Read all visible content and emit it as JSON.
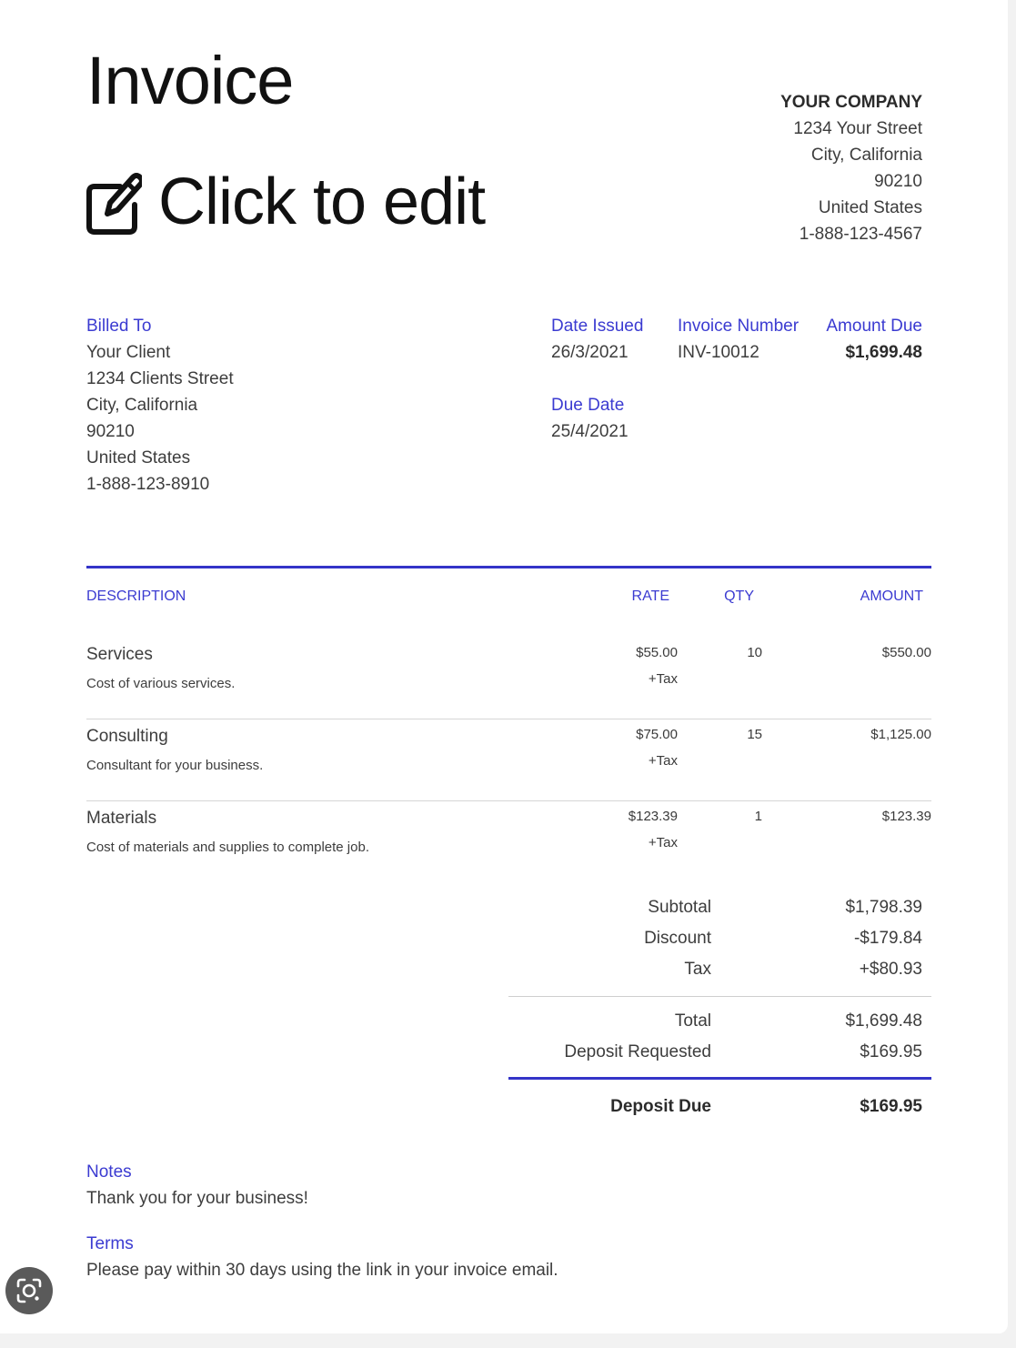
{
  "header": {
    "title": "Invoice",
    "edit_label": "Click to edit"
  },
  "company": {
    "name": "YOUR COMPANY",
    "street": "1234 Your Street",
    "city": "City, California",
    "zip": "90210",
    "country": "United States",
    "phone": "1-888-123-4567"
  },
  "billed_to": {
    "label": "Billed To",
    "name": "Your Client",
    "street": "1234 Clients Street",
    "city": "City, California",
    "zip": "90210",
    "country": "United States",
    "phone": "1-888-123-8910"
  },
  "meta": {
    "date_issued_label": "Date Issued",
    "date_issued": "26/3/2021",
    "invoice_number_label": "Invoice Number",
    "invoice_number": "INV-10012",
    "amount_due_label": "Amount Due",
    "amount_due": "$1,699.48",
    "due_date_label": "Due Date",
    "due_date": "25/4/2021"
  },
  "table": {
    "headers": {
      "description": "DESCRIPTION",
      "rate": "RATE",
      "qty": "QTY",
      "amount": "AMOUNT"
    },
    "rows": [
      {
        "description": "Services",
        "detail": "Cost of various services.",
        "rate": "$55.00",
        "tax": "+Tax",
        "qty": "10",
        "amount": "$550.00"
      },
      {
        "description": "Consulting",
        "detail": "Consultant for your business.",
        "rate": "$75.00",
        "tax": "+Tax",
        "qty": "15",
        "amount": "$1,125.00"
      },
      {
        "description": "Materials",
        "detail": "Cost of materials and supplies to complete job.",
        "rate": "$123.39",
        "tax": "+Tax",
        "qty": "1",
        "amount": "$123.39"
      }
    ]
  },
  "totals": {
    "subtotal_label": "Subtotal",
    "subtotal": "$1,798.39",
    "discount_label": "Discount",
    "discount": "-$179.84",
    "tax_label": "Tax",
    "tax": "+$80.93",
    "total_label": "Total",
    "total": "$1,699.48",
    "deposit_requested_label": "Deposit Requested",
    "deposit_requested": "$169.95",
    "deposit_due_label": "Deposit Due",
    "deposit_due": "$169.95"
  },
  "notes": {
    "label": "Notes",
    "text": "Thank you for your business!"
  },
  "terms": {
    "label": "Terms",
    "text": "Please pay within 30 days using the link in your invoice email."
  },
  "icons": {
    "edit": "edit-icon",
    "lens": "visual-search-icon"
  },
  "colors": {
    "accent": "#3b3bd1",
    "rule": "#3434c8"
  }
}
